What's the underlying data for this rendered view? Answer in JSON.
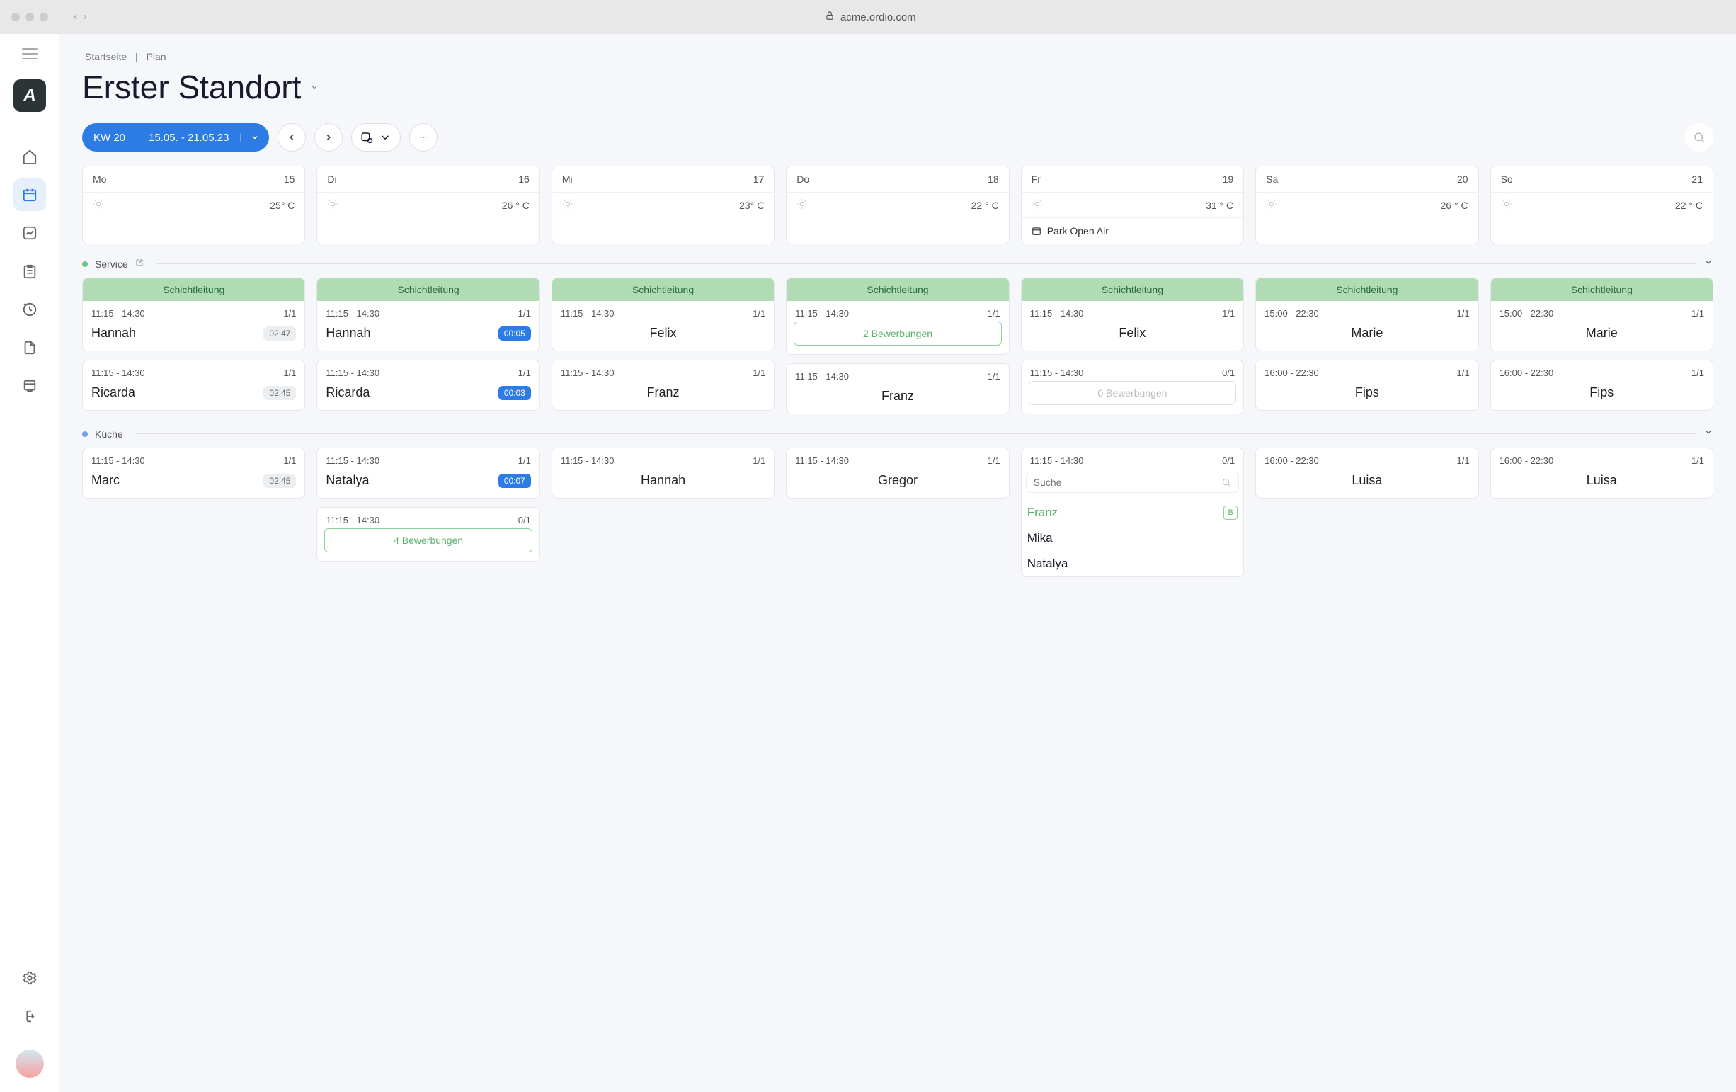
{
  "browser": {
    "url": "acme.ordio.com"
  },
  "breadcrumb": {
    "home": "Startseite",
    "sep": "|",
    "current": "Plan"
  },
  "title": "Erster Standort",
  "toolbar": {
    "week_label": "KW 20",
    "date_range": "15.05. - 21.05.23"
  },
  "days": [
    {
      "dow": "Mo",
      "num": "15",
      "temp": "25° C"
    },
    {
      "dow": "Di",
      "num": "16",
      "temp": "26 ° C"
    },
    {
      "dow": "Mi",
      "num": "17",
      "temp": "23° C"
    },
    {
      "dow": "Do",
      "num": "18",
      "temp": "22 ° C"
    },
    {
      "dow": "Fr",
      "num": "19",
      "temp": "31 ° C",
      "event": "Park Open Air"
    },
    {
      "dow": "Sa",
      "num": "20",
      "temp": "26 ° C"
    },
    {
      "dow": "So",
      "num": "21",
      "temp": "22 ° C"
    }
  ],
  "sections": {
    "service": {
      "name": "Service",
      "role_label": "Schichtleitung",
      "cols": [
        [
          {
            "role": true,
            "time": "11:15 - 14:30",
            "count": "1/1",
            "name": "Hannah",
            "badge": "02:47",
            "badge_style": "gray"
          },
          {
            "time": "11:15 - 14:30",
            "count": "1/1",
            "name": "Ricarda",
            "badge": "02:45",
            "badge_style": "gray"
          }
        ],
        [
          {
            "role": true,
            "time": "11:15 - 14:30",
            "count": "1/1",
            "name": "Hannah",
            "badge": "00:05",
            "badge_style": "blue"
          },
          {
            "time": "11:15 - 14:30",
            "count": "1/1",
            "name": "Ricarda",
            "badge": "00:03",
            "badge_style": "blue"
          }
        ],
        [
          {
            "role": true,
            "time": "11:15 - 14:30",
            "count": "1/1",
            "name": "Felix",
            "center": true
          },
          {
            "time": "11:15 - 14:30",
            "count": "1/1",
            "name": "Franz",
            "center": true
          }
        ],
        [
          {
            "role": true,
            "time": "11:15 - 14:30",
            "count": "1/1",
            "apply": "2 Bewerbungen"
          },
          {
            "time": "11:15 - 14:30",
            "count": "1/1",
            "name": "Franz",
            "center": true
          }
        ],
        [
          {
            "role": true,
            "time": "11:15 - 14:30",
            "count": "1/1",
            "name": "Felix",
            "center": true
          },
          {
            "time": "11:15 - 14:30",
            "count": "0/1",
            "apply": "0 Bewerbungen",
            "apply_muted": true
          }
        ],
        [
          {
            "role": true,
            "time": "15:00 - 22:30",
            "count": "1/1",
            "name": "Marie",
            "center": true
          },
          {
            "time": "16:00 - 22:30",
            "count": "1/1",
            "name": "Fips",
            "center": true
          }
        ],
        [
          {
            "role": true,
            "time": "15:00 - 22:30",
            "count": "1/1",
            "name": "Marie",
            "center": true
          },
          {
            "time": "16:00 - 22:30",
            "count": "1/1",
            "name": "Fips",
            "center": true
          }
        ]
      ]
    },
    "kitchen": {
      "name": "Küche",
      "cols": [
        [
          {
            "time": "11:15 - 14:30",
            "count": "1/1",
            "name": "Marc",
            "badge": "02:45",
            "badge_style": "gray"
          }
        ],
        [
          {
            "time": "11:15 - 14:30",
            "count": "1/1",
            "name": "Natalya",
            "badge": "00:07",
            "badge_style": "blue"
          },
          {
            "time": "11:15 - 14:30",
            "count": "0/1",
            "apply": "4 Bewerbungen"
          }
        ],
        [
          {
            "time": "11:15 - 14:30",
            "count": "1/1",
            "name": "Hannah",
            "center": true
          }
        ],
        [
          {
            "time": "11:15 - 14:30",
            "count": "1/1",
            "name": "Gregor",
            "center": true
          }
        ],
        [
          {
            "time": "11:15 - 14:30",
            "count": "0/1",
            "dropdown": true
          }
        ],
        [
          {
            "time": "16:00 - 22:30",
            "count": "1/1",
            "name": "Luisa",
            "center": true
          }
        ],
        [
          {
            "time": "16:00 - 22:30",
            "count": "1/1",
            "name": "Luisa",
            "center": true
          }
        ]
      ]
    }
  },
  "dropdown": {
    "search_placeholder": "Suche",
    "items": [
      {
        "name": "Franz",
        "highlighted": true,
        "badge": "B"
      },
      {
        "name": "Mika"
      },
      {
        "name": "Natalya"
      }
    ]
  }
}
